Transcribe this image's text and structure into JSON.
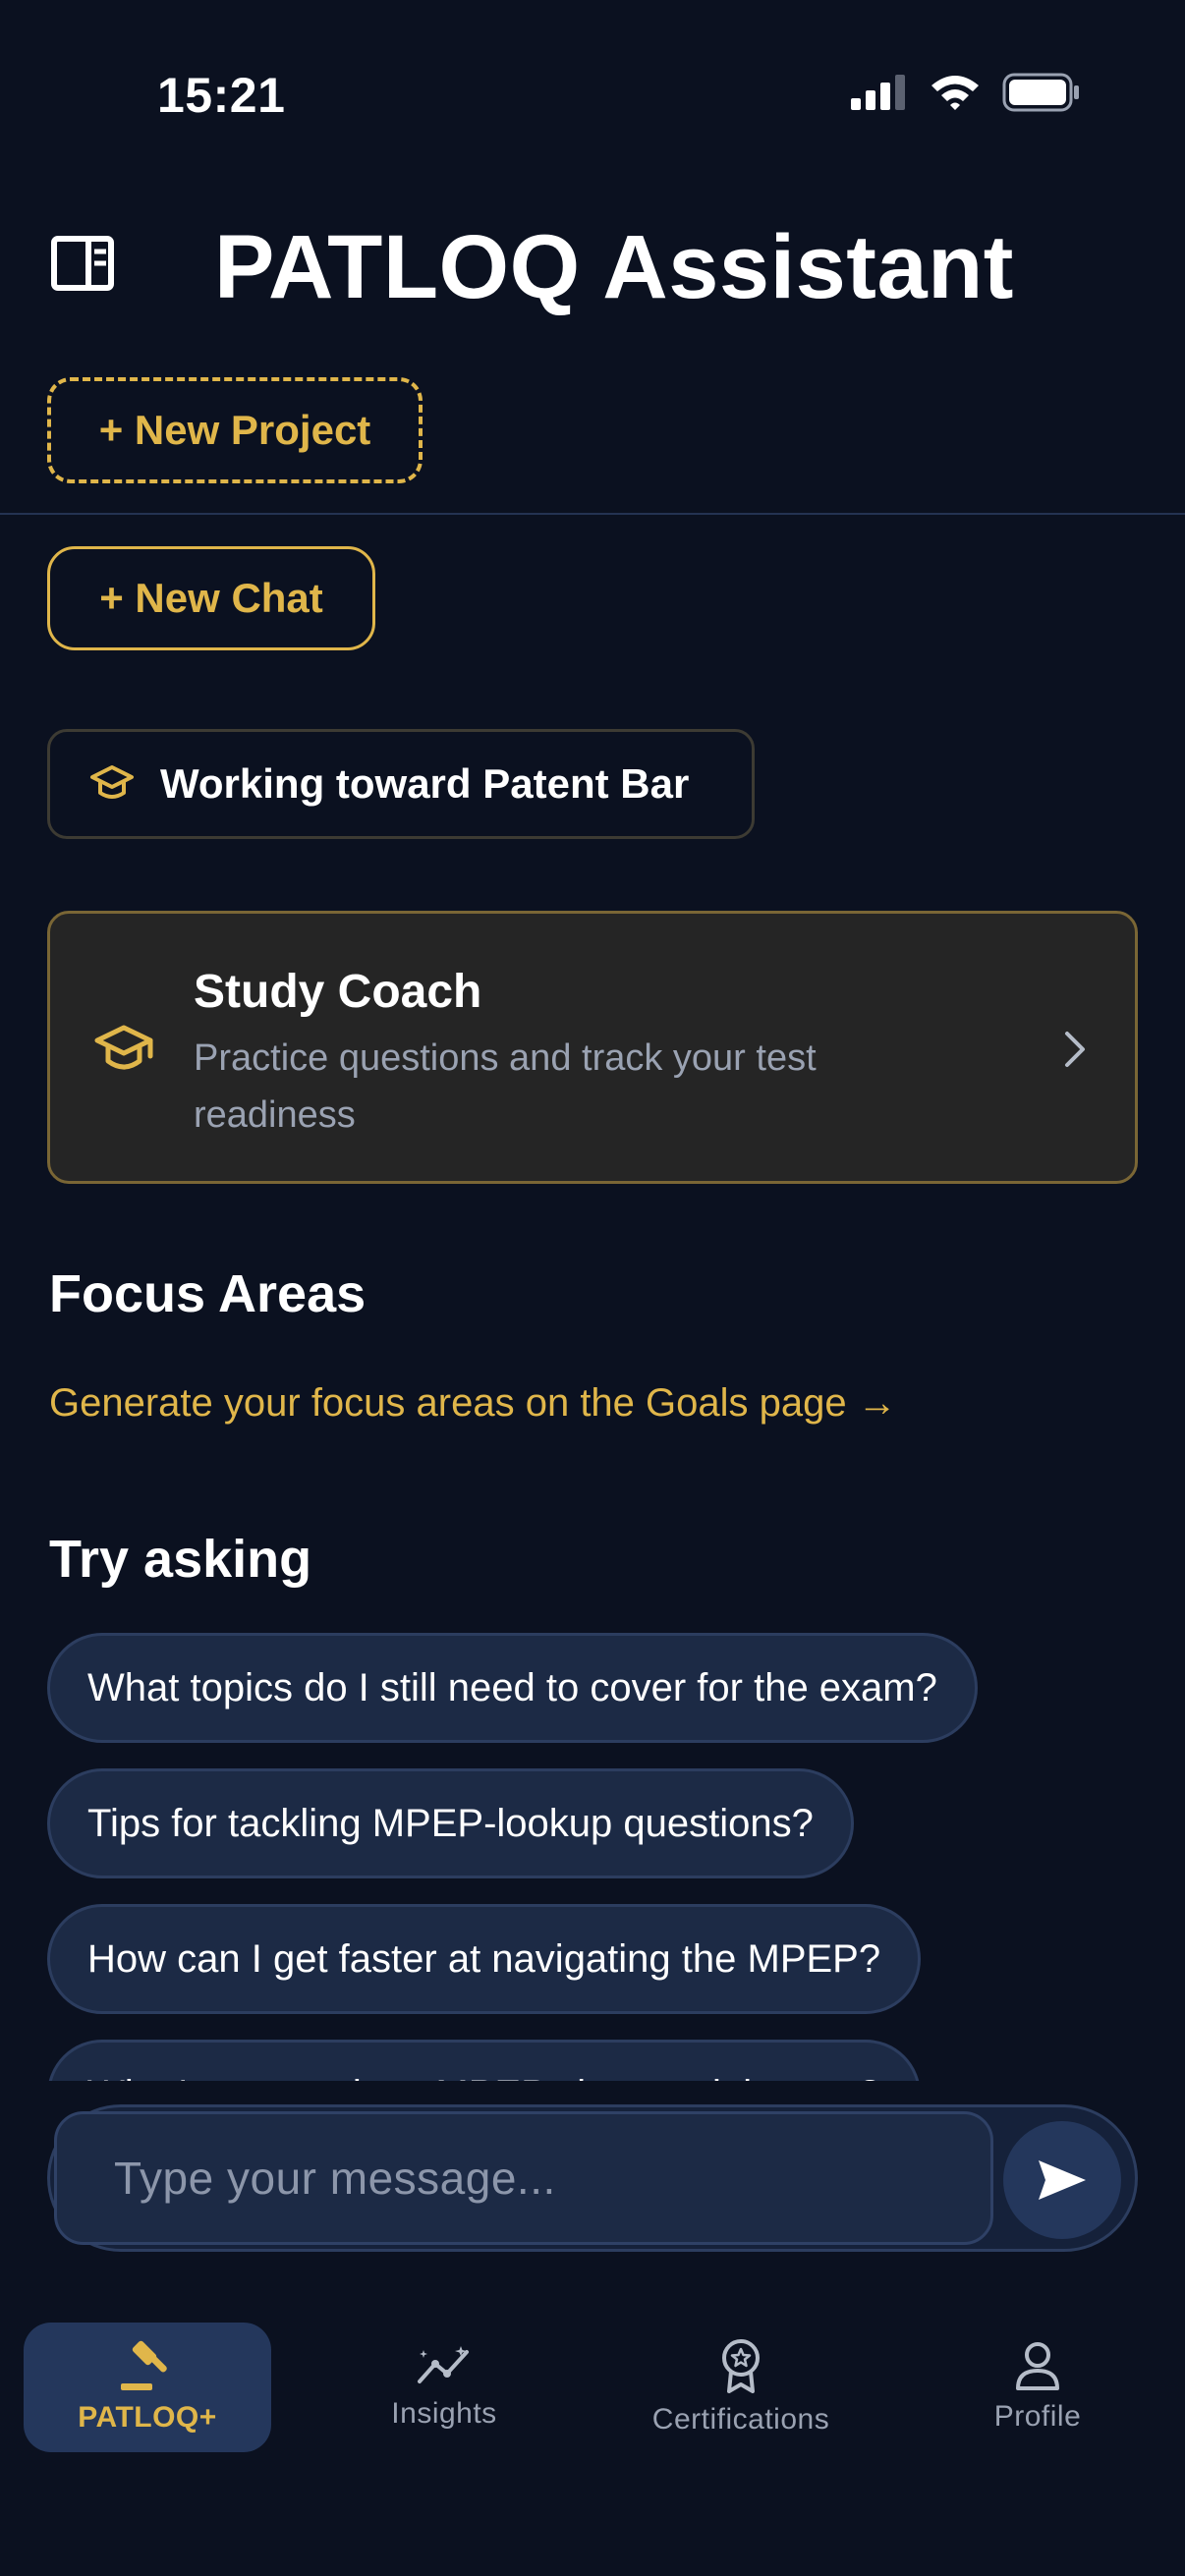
{
  "status_bar": {
    "time": "15:21"
  },
  "header": {
    "title": "PATLOQ Assistant"
  },
  "actions": {
    "new_project": "+ New Project",
    "new_chat": "+ New Chat"
  },
  "goal_chip": {
    "label": "Working toward Patent Bar"
  },
  "study_coach": {
    "title": "Study Coach",
    "subtitle": "Practice questions and track your test readiness"
  },
  "focus_areas": {
    "heading": "Focus Areas",
    "link": "Generate your focus areas on the Goals page →"
  },
  "try_asking": {
    "heading": "Try asking",
    "suggestions": [
      "What topics do I still need to cover for the exam?",
      "Tips for tackling MPEP-lookup questions?",
      "How can I get faster at navigating the MPEP?",
      "What's my weakest MPEP chapter right now?"
    ]
  },
  "composer": {
    "placeholder": "Type your message..."
  },
  "tabs": [
    {
      "label": "PATLOQ+",
      "icon": "gavel-icon",
      "active": true
    },
    {
      "label": "Insights",
      "icon": "insights-icon",
      "active": false
    },
    {
      "label": "Certifications",
      "icon": "award-icon",
      "active": false
    },
    {
      "label": "Profile",
      "icon": "person-icon",
      "active": false
    }
  ],
  "colors": {
    "background": "#0b1120",
    "accent": "#e0b64a",
    "card": "#252525",
    "chip": "#1c2a45",
    "muted_text": "#9aa2b2"
  }
}
